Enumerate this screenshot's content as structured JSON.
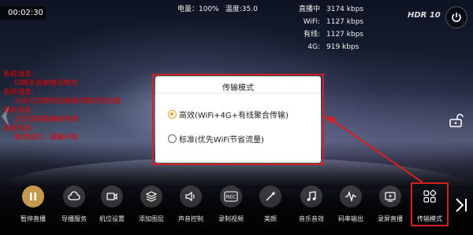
{
  "timer": "00:02:30",
  "stats": {
    "battery": "电量：100%",
    "temperature": "温度:35.0",
    "live": "直播中",
    "total": "3174 kbps",
    "wifi_label": "WiFi:",
    "wifi": "1127 kbps",
    "wired_label": "有线:",
    "wired": "1127 kbps",
    "g4_label": "4G:",
    "g4": "919 kbps"
  },
  "hdr": "HDR 10",
  "system_messages": [
    {
      "title": "系统消息:",
      "content": "切换至竖屏推流模式"
    },
    {
      "title": "系统消息:",
      "content": "点击可切换到竖屏推流模式的配置"
    },
    {
      "title": "系统消息:",
      "content": "正在连接直播服务器"
    },
    {
      "title": "系统消息:",
      "content": "推流成功，直播开始"
    }
  ],
  "dialog": {
    "title": "传输模式",
    "options": [
      {
        "label": "高效(WiFi+4G+有线聚合传输)",
        "selected": true
      },
      {
        "label": "标准(优先WiFi节省流量)",
        "selected": false
      }
    ]
  },
  "toolbar": [
    {
      "label": "暂停直播",
      "icon": "pause-icon"
    },
    {
      "label": "导播服务",
      "icon": "cloud-icon"
    },
    {
      "label": "机位设置",
      "icon": "camera-icon"
    },
    {
      "label": "添加图层",
      "icon": "layers-icon"
    },
    {
      "label": "声音控制",
      "icon": "speaker-icon"
    },
    {
      "label": "录制视频",
      "icon": "rec-icon"
    },
    {
      "label": "美颜",
      "icon": "magic-wand-icon"
    },
    {
      "label": "音乐音效",
      "icon": "music-icon"
    },
    {
      "label": "码率输出",
      "icon": "waveform-icon"
    },
    {
      "label": "录屏直播",
      "icon": "screen-record-icon"
    },
    {
      "label": "传输模式",
      "icon": "grid-icon"
    }
  ],
  "colors": {
    "accent": "#e8a12c",
    "highlight": "#d81f1f",
    "message_text": "#e60000",
    "pause_button": "#c69a4e"
  }
}
